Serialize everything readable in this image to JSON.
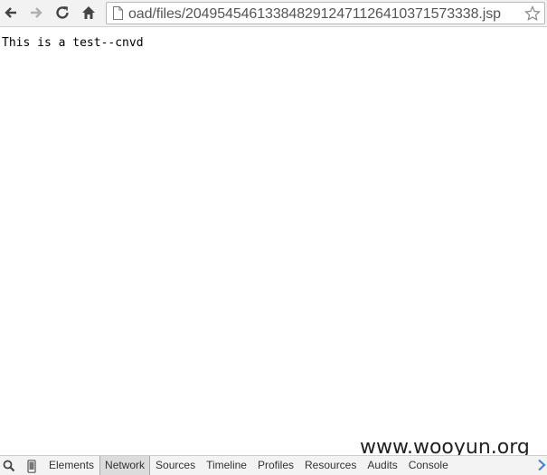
{
  "toolbar": {
    "back_icon": "back-arrow-icon",
    "forward_icon": "forward-arrow-icon",
    "reload_icon": "reload-icon",
    "home_icon": "home-icon",
    "url": "oad/files/2049545461338482912471126410371573338.jsp",
    "bookmark_icon": "star-icon"
  },
  "page": {
    "text": "This is a test--cnvd"
  },
  "devtools": {
    "search_icon": "search-icon",
    "device_icon": "mobile-device-icon",
    "tabs": [
      {
        "label": "Elements",
        "selected": false
      },
      {
        "label": "Network",
        "selected": true
      },
      {
        "label": "Sources",
        "selected": false
      },
      {
        "label": "Timeline",
        "selected": false
      },
      {
        "label": "Profiles",
        "selected": false
      },
      {
        "label": "Resources",
        "selected": false
      },
      {
        "label": "Audits",
        "selected": false
      },
      {
        "label": "Console",
        "selected": false
      }
    ],
    "more_icon": "chevron-right-icon"
  },
  "watermark": "www.wooyun.org",
  "colors": {
    "toolbar_bg": "#f2f2f2",
    "devtools_bg": "#f3f3f3",
    "selected_tab_bg": "#dcdcdc",
    "more_arrow": "#3b7dd8"
  }
}
